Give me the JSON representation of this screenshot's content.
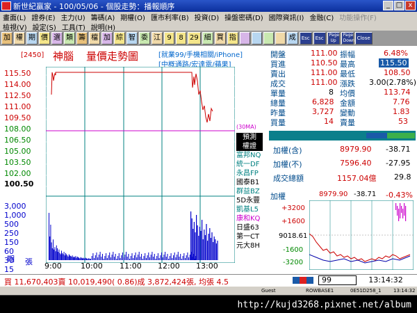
{
  "window": {
    "title": "新世紀贏家 - 100/05/06 - 個股走勢：播報順序",
    "controls": [
      "_",
      "□",
      "x"
    ]
  },
  "menu": {
    "row1": [
      "畫面(L)",
      "證券(E)",
      "主力(U)",
      "籌碼(A)",
      "期權(O)",
      "匯市利率(B)",
      "投資(D)",
      "操盤密碼(D)",
      "國際資訊(I)",
      "金融(C)",
      "功能操作(F)"
    ],
    "row2": [
      "檢視(V)",
      "設定(S)",
      "工具(T)",
      "說明(H)"
    ]
  },
  "toolbar": {
    "buttons": [
      "加",
      "權",
      "期",
      "價",
      "選",
      "類",
      "籌",
      "檔",
      "加",
      "綜",
      "智",
      "委",
      "江",
      "9",
      "8",
      "29",
      "細",
      "買",
      "指",
      "",
      "",
      "",
      "",
      "成",
      "Esc",
      "Esc",
      "Page Up",
      "Page Down",
      "Close"
    ]
  },
  "header": {
    "code": "[2450]",
    "name": "神腦",
    "title": "量價走勢圖",
    "sector1": "[就業99/手機相關/iPhone]",
    "sector2": "[中概通路/宏達電/蘋果]"
  },
  "y_axis": {
    "price_labels": [
      "115.50",
      "114.00",
      "112.50",
      "111.00",
      "109.50",
      "108.00",
      "106.50",
      "105.00",
      "103.50",
      "102.00",
      "100.50"
    ],
    "volume_labels": [
      "3,000",
      "1,000",
      "500",
      "250",
      "150",
      "60",
      "30",
      "15"
    ],
    "period_label": "期",
    "unit_label": "張"
  },
  "x_axis": {
    "labels": [
      "9:00",
      "10:00",
      "11:00",
      "12:00",
      "13:00"
    ]
  },
  "annotations": {
    "ref_marker": "(30MA)"
  },
  "brokers": {
    "head1": "預測",
    "head2": "權證",
    "items": [
      {
        "name": "富邦NQ",
        "color": "teal"
      },
      {
        "name": "統一DF",
        "color": "teal"
      },
      {
        "name": "永昌FP",
        "color": "teal"
      },
      {
        "name": "國泰B1",
        "color": "blk"
      },
      {
        "name": "群益BZ",
        "color": "teal"
      },
      {
        "name": "5D永豐",
        "color": "blk"
      },
      {
        "name": "凱基L5",
        "color": "teal"
      },
      {
        "name": "康和KQ",
        "color": "mag"
      },
      {
        "name": "日盛63",
        "color": "blk"
      },
      {
        "name": "第一CT",
        "color": "blk"
      },
      {
        "name": "元大8H",
        "color": "blk"
      }
    ]
  },
  "quote": {
    "rows": [
      {
        "l1": "開盤",
        "v1": "111.00",
        "c1": "red",
        "l2": "振幅",
        "v2": "6.48%",
        "c2": "red"
      },
      {
        "l1": "買進",
        "v1": "110.50",
        "c1": "red",
        "l2": "最高",
        "v2": "115.50",
        "c2": "hi"
      },
      {
        "l1": "賣出",
        "v1": "111.00",
        "c1": "red",
        "l2": "最低",
        "v2": "108.50",
        "c2": "red"
      },
      {
        "l1": "成交",
        "v1": "111.00",
        "c1": "red",
        "l2": "漲跌",
        "v2": "3.00(2.78%)",
        "c2": "blk"
      },
      {
        "l1": "單量",
        "v1": "8",
        "c1": "blk",
        "l2": "均價",
        "v2": "113.74",
        "c2": "red"
      },
      {
        "l1": "總量",
        "v1": "6,828",
        "c1": "red",
        "l2": "金額",
        "v2": "7.76",
        "c2": "red"
      },
      {
        "l1": "昨量",
        "v1": "3,727",
        "c1": "red",
        "l2": "變動",
        "v2": "1.83",
        "c2": "red"
      },
      {
        "l1": "買量",
        "v1": "14",
        "c1": "red",
        "l2": "賣量",
        "v2": "53",
        "c2": "red"
      }
    ]
  },
  "index": {
    "rows": [
      {
        "label": "加權(含)",
        "val": "8979.90",
        "chg": "-38.71"
      },
      {
        "label": "加權(不)",
        "val": "7596.40",
        "chg": "-27.95"
      },
      {
        "label": "成交總額",
        "val": "1157.04億",
        "chg": "29.8"
      }
    ]
  },
  "mini_chart": {
    "title": "加權",
    "price": "8979.90",
    "chg": "-38.71",
    "pct": "-0.43%",
    "labels": [
      "+3200",
      "+1600",
      "9018.61",
      "-1600",
      "-3200"
    ]
  },
  "status": {
    "ticker": "買 11,670,403賣 10,019,490( 0.86)成 3,872,424張, 均張 4.5",
    "code_input": "99",
    "clock": "13:14:32"
  },
  "infobar": {
    "items": [
      "Guest",
      "ROWBASE1",
      "0E51D258_1",
      "13:14:32"
    ]
  },
  "url": {
    "text": "http://kujd3268.pixnet.net/album"
  },
  "colors": {
    "price_line": "#cc0000",
    "ma_line": "#cc00cc",
    "volume_bar": "#0000cc",
    "ref_line": "#008080"
  }
}
